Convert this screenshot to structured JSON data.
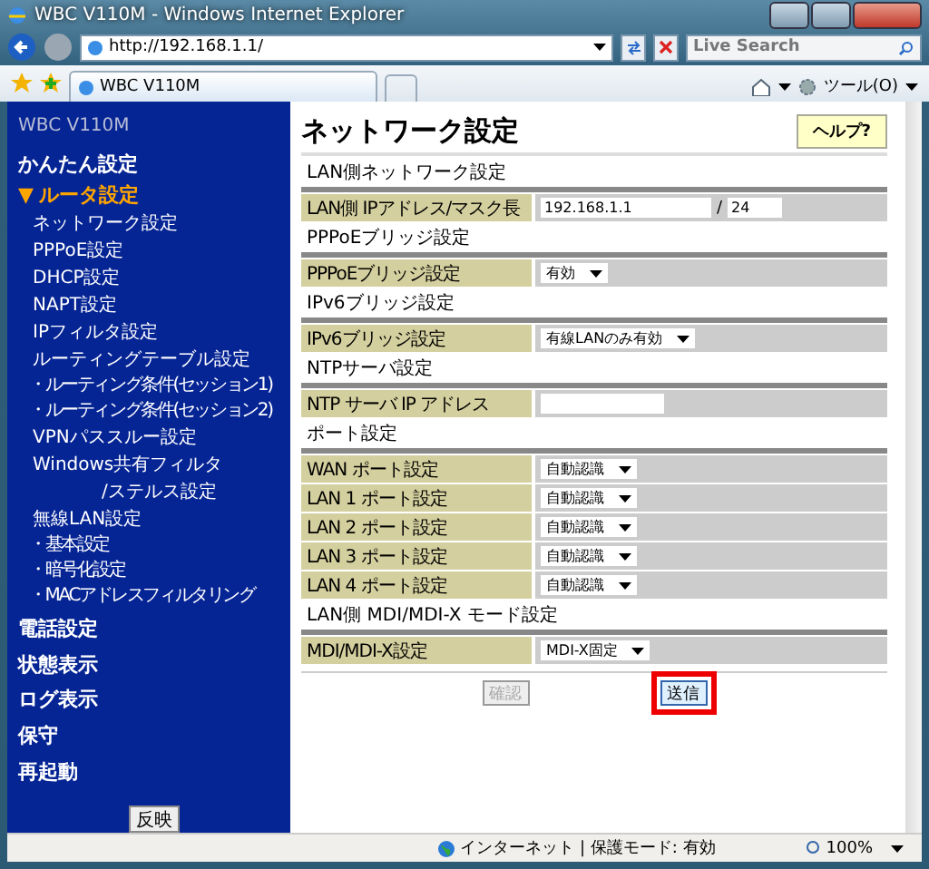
{
  "window": {
    "title": "WBC V110M - Windows Internet Explorer"
  },
  "address_bar": {
    "value": "http://192.168.1.1/"
  },
  "search": {
    "placeholder": "Live Search"
  },
  "tabs": [
    {
      "label": "WBC V110M",
      "selected": true
    }
  ],
  "toolbar": {
    "tools_label": "ツール(O)"
  },
  "sidebar": {
    "brand": "WBC V110M",
    "items": [
      {
        "kind": "top",
        "label": "かんたん設定"
      },
      {
        "kind": "section",
        "marker": "▼",
        "label": "ルータ設定",
        "expanded": true,
        "children": [
          {
            "lines": [
              "ネットワーク設定"
            ]
          },
          {
            "lines": [
              "PPPoE設定"
            ]
          },
          {
            "lines": [
              "DHCP設定"
            ]
          },
          {
            "lines": [
              "NAPT設定"
            ]
          },
          {
            "lines": [
              "IPフィルタ設定"
            ]
          },
          {
            "lines": [
              "ルーティングテーブル設定"
            ],
            "children": [
              {
                "label": "・ルーティング条件(セッション1)"
              },
              {
                "label": "・ルーティング条件(セッション2)"
              }
            ]
          },
          {
            "lines": [
              "VPNパススルー設定"
            ]
          },
          {
            "lines": [
              "Windows共有フィルタ",
              "/ステルス設定"
            ]
          },
          {
            "lines": [
              "無線LAN設定"
            ],
            "children": [
              {
                "label": "・基本設定"
              },
              {
                "label": "・暗号化設定"
              },
              {
                "label": "・MACアドレスフィルタリング"
              }
            ]
          }
        ]
      },
      {
        "kind": "top",
        "label": "電話設定"
      },
      {
        "kind": "top",
        "label": "状態表示"
      },
      {
        "kind": "top",
        "label": "ログ表示"
      },
      {
        "kind": "top",
        "label": "保守"
      },
      {
        "kind": "top",
        "label": "再起動"
      }
    ],
    "apply_button": "反映"
  },
  "main": {
    "title": "ネットワーク設定",
    "help_button": "ヘルプ?",
    "sections": [
      {
        "heading": "LAN側ネットワーク設定",
        "rows": [
          {
            "label": "LAN側 IPアドレス/マスク長",
            "kind": "ip_mask",
            "value": "192.168.1.1",
            "separator": "/",
            "mask": "24"
          }
        ]
      },
      {
        "heading": "PPPoEブリッジ設定",
        "rows": [
          {
            "label": "PPPoEブリッジ設定",
            "kind": "select",
            "value": "有効"
          }
        ]
      },
      {
        "heading": "IPv6ブリッジ設定",
        "rows": [
          {
            "label": "IPv6ブリッジ設定",
            "kind": "select",
            "value": "有線LANのみ有効"
          }
        ]
      },
      {
        "heading": "NTPサーバ設定",
        "rows": [
          {
            "label": "NTP サーバ IP アドレス",
            "kind": "text"
          }
        ]
      },
      {
        "heading": "ポート設定",
        "rows": [
          {
            "label": "WAN ポート設定",
            "kind": "select",
            "value": "自動認識"
          },
          {
            "label": "LAN 1 ポート設定",
            "kind": "select",
            "value": "自動認識"
          },
          {
            "label": "LAN 2 ポート設定",
            "kind": "select",
            "value": "自動認識"
          },
          {
            "label": "LAN 3 ポート設定",
            "kind": "select",
            "value": "自動認識"
          },
          {
            "label": "LAN 4 ポート設定",
            "kind": "select",
            "value": "自動認識"
          }
        ]
      },
      {
        "heading": "LAN側 MDI/MDI-X モード設定",
        "rows": [
          {
            "label": "MDI/MDI-X設定",
            "kind": "select",
            "value": "MDI-X固定"
          }
        ]
      }
    ],
    "confirm_button": {
      "label": "確認",
      "disabled": true
    },
    "submit_button": {
      "label": "送信",
      "highlighted": true
    }
  },
  "status_bar": {
    "zone": "インターネット | 保護モード: 有効",
    "zoom": "100%"
  }
}
